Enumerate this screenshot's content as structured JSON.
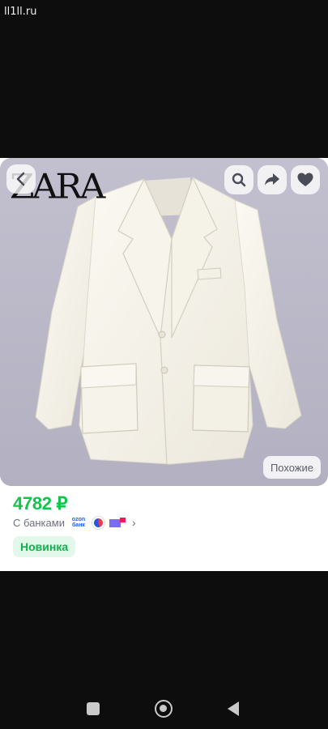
{
  "watermark": "ll1ll.ru",
  "product": {
    "brand_logo": "ZARA",
    "price": "4782 ₽",
    "banks_label": "С банками",
    "bank_logos": [
      "ozon-bank-logo",
      "circle-bank-logo",
      "flag-bank-logo"
    ],
    "ozon_logo_text": "ozon\nбанк",
    "badge": "Новинка",
    "similar_label": "Похожие"
  },
  "toolbar": {
    "back_icon": "chevron-left-icon",
    "search_icon": "search-icon",
    "share_icon": "share-icon",
    "favorite_icon": "heart-icon"
  },
  "colors": {
    "price": "#10c44c",
    "badge_bg": "#e2f8ea",
    "badge_text": "#10b24a",
    "photo_bg": "#bcbac9"
  },
  "navbar": {
    "icons": [
      "recent-apps-icon",
      "home-icon",
      "back-icon"
    ]
  }
}
